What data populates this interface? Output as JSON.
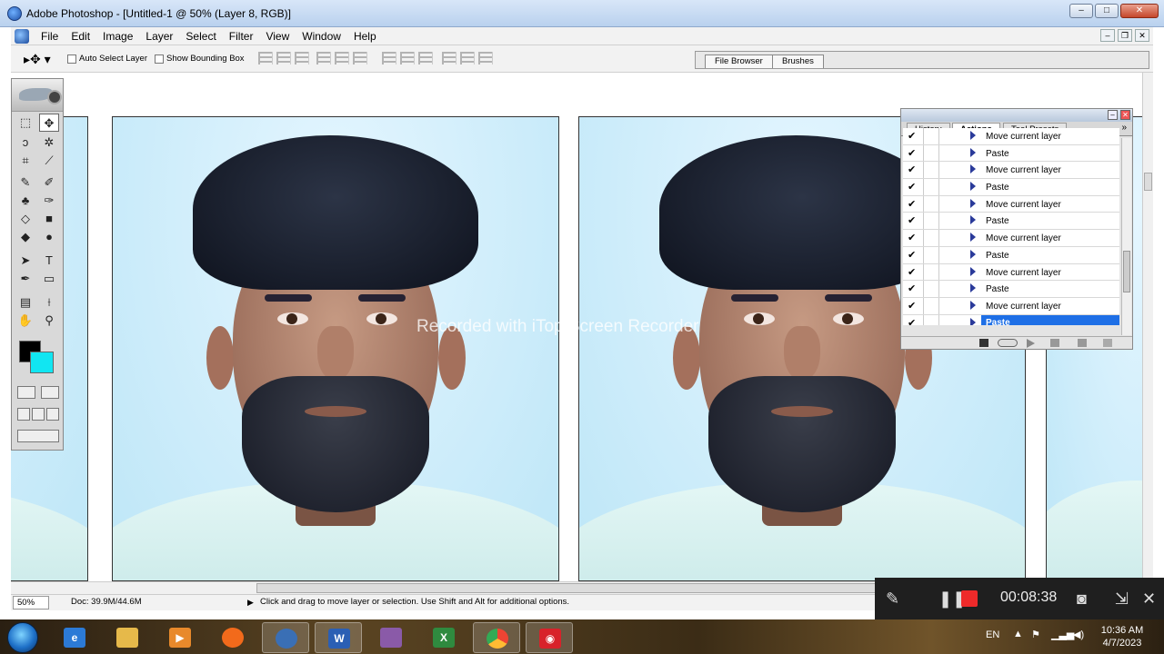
{
  "window": {
    "title": "Adobe Photoshop - [Untitled-1 @ 50% (Layer 8, RGB)]",
    "controls": [
      "–",
      "□",
      "✕"
    ],
    "doc_controls": [
      "–",
      "❐",
      "✕"
    ]
  },
  "menu": [
    "File",
    "Edit",
    "Image",
    "Layer",
    "Select",
    "Filter",
    "View",
    "Window",
    "Help"
  ],
  "options": {
    "auto_select_layer": "Auto Select Layer",
    "show_bounding_box": "Show Bounding Box",
    "well_tabs": [
      "File Browser",
      "Brushes"
    ]
  },
  "watermark": "Recorded with iTop Screen Recorder",
  "status": {
    "zoom": "50%",
    "doc_size": "Doc: 39.9M/44.6M",
    "tip": "Click and drag to move layer or selection.  Use Shift and Alt for additional options."
  },
  "colors": {
    "foreground": "#000000",
    "background": "#11e6f2",
    "selection": "#1e6fe6",
    "record_red": "#ee2a2a"
  },
  "palette": {
    "tabs": [
      "History",
      "Actions",
      "Tool Presets"
    ],
    "active_tab": "Actions",
    "rows": [
      {
        "label": "Move current layer",
        "checked": true,
        "selected": false
      },
      {
        "label": "Paste",
        "checked": true,
        "selected": false
      },
      {
        "label": "Move current layer",
        "checked": true,
        "selected": false
      },
      {
        "label": "Paste",
        "checked": true,
        "selected": false
      },
      {
        "label": "Move current layer",
        "checked": true,
        "selected": false
      },
      {
        "label": "Paste",
        "checked": true,
        "selected": false
      },
      {
        "label": "Move current layer",
        "checked": true,
        "selected": false
      },
      {
        "label": "Paste",
        "checked": true,
        "selected": false
      },
      {
        "label": "Move current layer",
        "checked": true,
        "selected": false
      },
      {
        "label": "Paste",
        "checked": true,
        "selected": false
      },
      {
        "label": "Move current layer",
        "checked": true,
        "selected": false
      },
      {
        "label": "Paste",
        "checked": true,
        "selected": true
      }
    ]
  },
  "recorder": {
    "timer": "00:08:38",
    "icons": [
      "pen-icon",
      "pause-icon",
      "stop-icon",
      "camera-icon",
      "minimize-icon",
      "close-icon"
    ]
  },
  "taskbar": {
    "apps": [
      "start-icon",
      "internet-explorer-icon",
      "file-explorer-icon",
      "media-player-icon",
      "firefox-icon",
      "photoshop-icon",
      "word-icon",
      "winrar-icon",
      "excel-icon",
      "chrome-icon",
      "screen-recorder-icon"
    ],
    "lang": "EN",
    "time": "10:36 AM",
    "date": "4/7/2023"
  }
}
